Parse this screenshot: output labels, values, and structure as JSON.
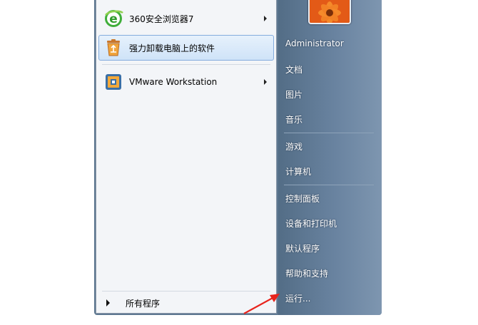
{
  "left_pane": {
    "programs": [
      {
        "label": "360安全浏览器7",
        "has_submenu": true,
        "icon": "ie-style-browser-icon"
      },
      {
        "label": "强力卸载电脑上的软件",
        "has_submenu": false,
        "icon": "recycle-uninstall-icon",
        "selected": true
      },
      {
        "label": "VMware Workstation",
        "has_submenu": true,
        "icon": "vmware-icon"
      }
    ],
    "all_programs_label": "所有程序"
  },
  "right_pane": {
    "user_name": "Administrator",
    "items": [
      "文档",
      "图片",
      "音乐",
      "游戏",
      "计算机",
      "控制面板",
      "设备和打印机",
      "默认程序",
      "帮助和支持",
      "运行..."
    ]
  },
  "colors": {
    "right_pane": "#5d7790",
    "selection": "#cfe3f8",
    "arrow": "#e8231c"
  }
}
